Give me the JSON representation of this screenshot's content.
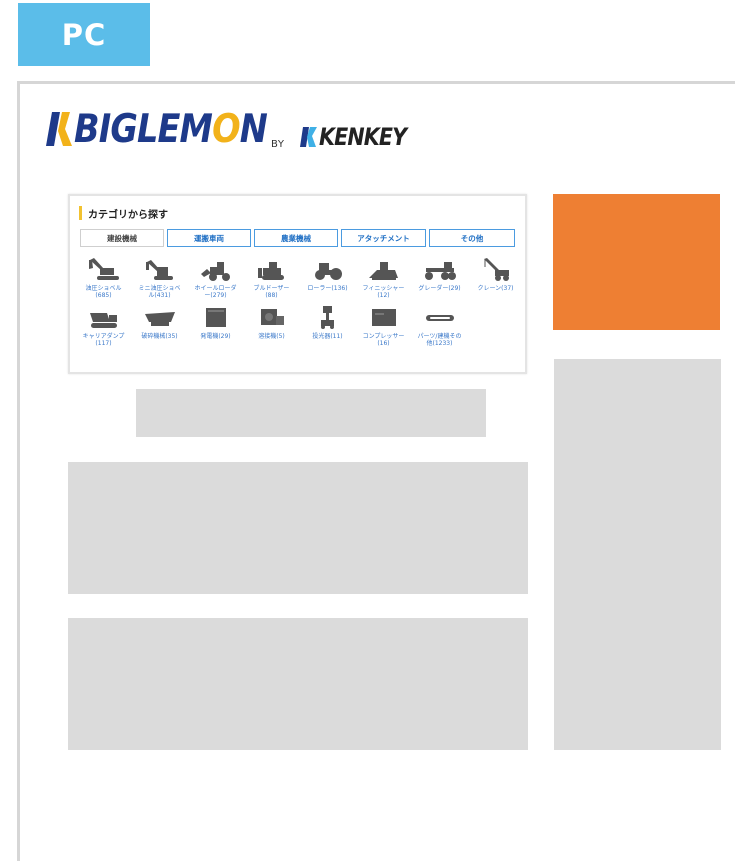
{
  "badge": {
    "label": "PC"
  },
  "logo": {
    "main": "BIGLEM",
    "main_o": "O",
    "main_end": "N",
    "by": "BY",
    "partner": "KENKEY"
  },
  "category": {
    "title": "カテゴリから探す",
    "tabs": [
      {
        "label": "建設機械",
        "active": true
      },
      {
        "label": "運搬車両",
        "active": false
      },
      {
        "label": "農業機械",
        "active": false
      },
      {
        "label": "アタッチメント",
        "active": false
      },
      {
        "label": "その他",
        "active": false
      }
    ],
    "items": [
      {
        "label": "油圧ショベル\n(685)",
        "icon": "excavator-icon"
      },
      {
        "label": "ミニ油圧ショベ\nル(431)",
        "icon": "mini-excavator-icon"
      },
      {
        "label": "ホイールローダ\nー(279)",
        "icon": "wheel-loader-icon"
      },
      {
        "label": "ブルドーザー\n(88)",
        "icon": "bulldozer-icon"
      },
      {
        "label": "ローラー(136)",
        "icon": "roller-icon"
      },
      {
        "label": "フィニッシャー\n(12)",
        "icon": "finisher-icon"
      },
      {
        "label": "グレーダー(29)",
        "icon": "grader-icon"
      },
      {
        "label": "クレーン(37)",
        "icon": "crane-icon"
      },
      {
        "label": "キャリアダンプ\n(117)",
        "icon": "carrier-dump-icon"
      },
      {
        "label": "破砕機械(35)",
        "icon": "crusher-icon"
      },
      {
        "label": "発電機(29)",
        "icon": "generator-icon"
      },
      {
        "label": "溶接機(5)",
        "icon": "welder-icon"
      },
      {
        "label": "投光器(11)",
        "icon": "floodlight-icon"
      },
      {
        "label": "コンプレッサー\n(16)",
        "icon": "compressor-icon"
      },
      {
        "label": "パーツ/建機その\n他(1233)",
        "icon": "parts-icon"
      }
    ]
  },
  "colors": {
    "badge": "#5bbde9",
    "ad": "#ee7f33",
    "placeholder": "#dbdbdb",
    "brand_blue": "#1e3a8a",
    "brand_yellow": "#f2b21a"
  }
}
